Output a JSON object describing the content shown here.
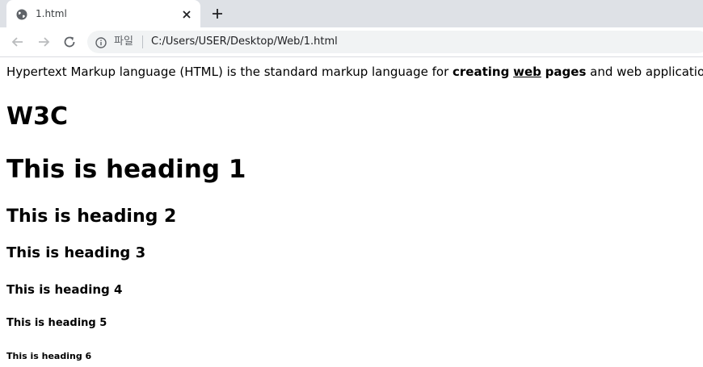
{
  "tab": {
    "title": "1.html",
    "favicon": "globe-icon",
    "close": "close-icon"
  },
  "new_tab": "plus-icon",
  "toolbar": {
    "back": "back-arrow-icon",
    "forward": "forward-arrow-icon",
    "reload": "reload-icon",
    "info": "info-icon",
    "scheme_label": "파일",
    "url": "C:/Users/USER/Desktop/Web/1.html"
  },
  "page": {
    "intro": {
      "part1": "Hypertext Markup language (HTML) is the standard markup language for ",
      "bold1": "creating",
      "bold_underlined": "web",
      "bold2": "pages",
      "part2": " and web applications."
    },
    "headings": {
      "w3c": "W3C",
      "h1": "This is heading 1",
      "h2": "This is heading 2",
      "h3": "This is heading 3",
      "h4": "This is heading 4",
      "h5": "This is heading 5",
      "h6": "This is heading 6"
    }
  },
  "colors": {
    "tabstrip": "#dee1e6",
    "omnibox": "#f1f3f4",
    "icon": "#5f6368"
  }
}
